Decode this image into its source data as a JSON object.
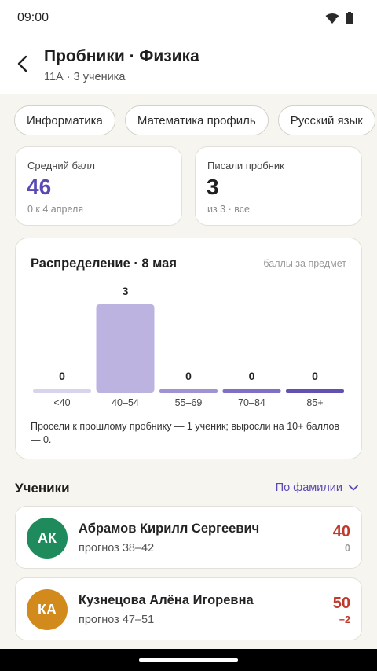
{
  "status": {
    "time": "09:00"
  },
  "header": {
    "title": "Пробники · Физика",
    "subtitle": "11А · 3 ученика",
    "back_icon": "arrow-back-icon"
  },
  "subjects": [
    "Информатика",
    "Математика профиль",
    "Русский язык"
  ],
  "stats": {
    "avg": {
      "label": "Средний балл",
      "value": "46",
      "note": "0 к 4 апреля",
      "color": "#5a48b5"
    },
    "wrote": {
      "label": "Писали пробник",
      "value": "3",
      "note": "из 3 · все"
    }
  },
  "distribution": {
    "title": "Распределение · 8 мая",
    "unit": "баллы за предмет",
    "note": "Просели к прошлому пробнику — 1 ученик; выросли на 10+ баллов — 0."
  },
  "chart_data": {
    "type": "bar",
    "categories": [
      "<40",
      "40–54",
      "55–69",
      "70–84",
      "85+"
    ],
    "values": [
      0,
      3,
      0,
      0,
      0
    ],
    "colors": [
      "#d9d4ee",
      "#bcb3e0",
      "#9f93d4",
      "#7f6fc6",
      "#6350b3"
    ]
  },
  "students_section": {
    "title": "Ученики",
    "sort_label": "По фамилии"
  },
  "students": [
    {
      "initials": "АК",
      "name": "Абрамов Кирилл Сергеевич",
      "forecast": "прогноз 38–42",
      "score": "40",
      "delta": "0",
      "avatar_color": "#1f8a5b",
      "delta_color": "#9a9a9a"
    },
    {
      "initials": "КА",
      "name": "Кузнецова Алёна Игоревна",
      "forecast": "прогноз 47–51",
      "score": "50",
      "delta": "−2",
      "avatar_color": "#d28a1c",
      "delta_color": "#c0392b"
    }
  ]
}
